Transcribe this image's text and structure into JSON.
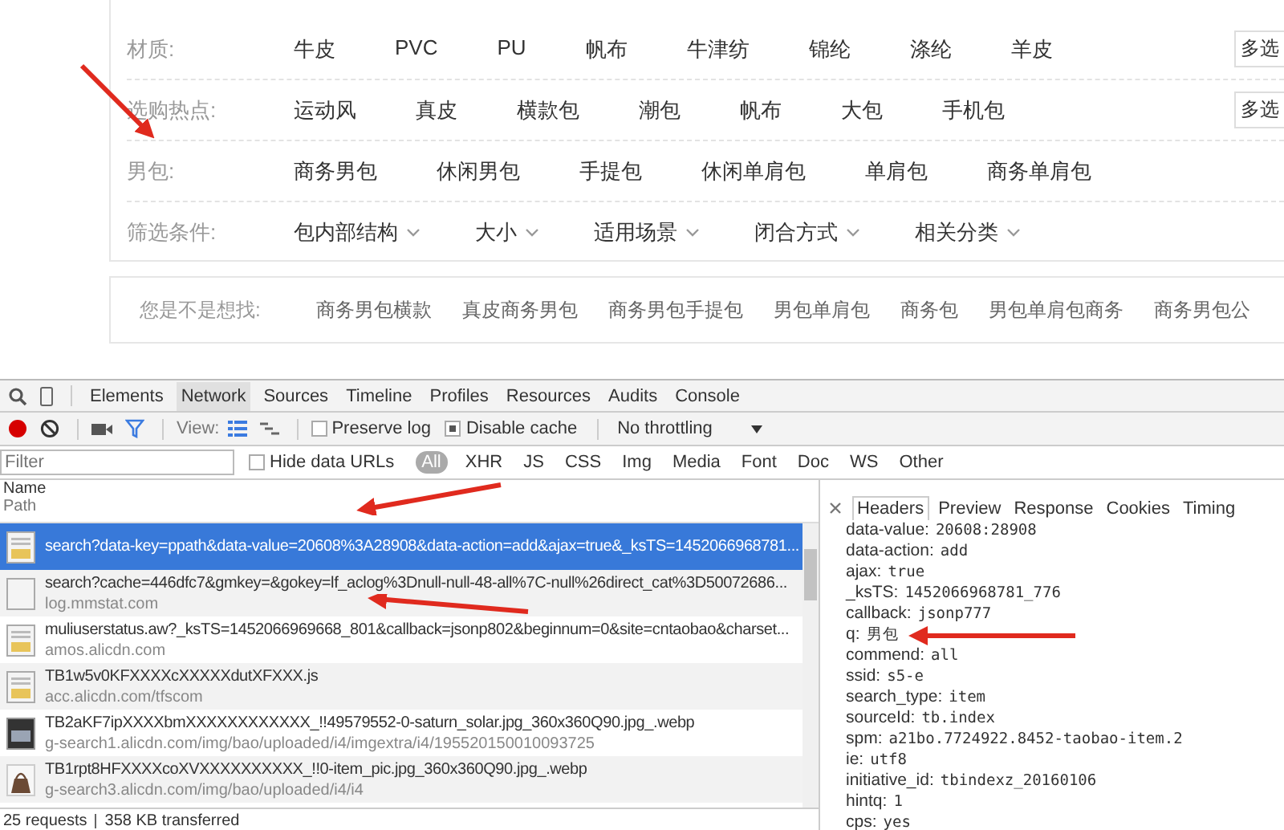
{
  "filters": [
    {
      "label": "材质:",
      "kind": "plain",
      "options": [
        "牛皮",
        "PVC",
        "PU",
        "帆布",
        "牛津纺",
        "锦纶",
        "涤纶",
        "羊皮"
      ],
      "multi": "多选"
    },
    {
      "label": "选购热点:",
      "kind": "plain",
      "options": [
        "运动风",
        "真皮",
        "横款包",
        "潮包",
        "帆布",
        "大包",
        "手机包"
      ],
      "multi": "多选"
    },
    {
      "label": "男包:",
      "kind": "plain",
      "options": [
        "商务男包",
        "休闲男包",
        "手提包",
        "休闲单肩包",
        "单肩包",
        "商务单肩包"
      ]
    },
    {
      "label": "筛选条件:",
      "kind": "dropdown",
      "options": [
        "包内部结构",
        "大小",
        "适用场景",
        "闭合方式",
        "相关分类"
      ]
    }
  ],
  "suggest": {
    "label": "您是不是想找:",
    "items": [
      "商务男包横款",
      "真皮商务男包",
      "商务男包手提包",
      "男包单肩包",
      "商务包",
      "男包单肩包商务",
      "商务男包公"
    ]
  },
  "devtools": {
    "tabs": [
      {
        "label": "Elements",
        "selected": false
      },
      {
        "label": "Network",
        "selected": true
      },
      {
        "label": "Sources",
        "selected": false
      },
      {
        "label": "Timeline",
        "selected": false
      },
      {
        "label": "Profiles",
        "selected": false
      },
      {
        "label": "Resources",
        "selected": false
      },
      {
        "label": "Audits",
        "selected": false
      },
      {
        "label": "Console",
        "selected": false
      }
    ],
    "recording": true,
    "view_label": "View:",
    "preserve_log": {
      "label": "Preserve log",
      "checked": false
    },
    "disable_cache": {
      "label": "Disable cache",
      "checked": true
    },
    "throttling": "No throttling",
    "filter": {
      "placeholder": "Filter"
    },
    "hide_data_urls": {
      "label": "Hide data URLs",
      "checked": false
    },
    "types": [
      {
        "label": "All",
        "selected": true
      },
      {
        "label": "XHR",
        "selected": false
      },
      {
        "label": "JS",
        "selected": false
      },
      {
        "label": "CSS",
        "selected": false
      },
      {
        "label": "Img",
        "selected": false
      },
      {
        "label": "Media",
        "selected": false
      },
      {
        "label": "Font",
        "selected": false
      },
      {
        "label": "Doc",
        "selected": false
      },
      {
        "label": "WS",
        "selected": false
      },
      {
        "label": "Other",
        "selected": false
      }
    ],
    "columns": [
      "Name",
      "Path"
    ],
    "requests": [
      {
        "kind": "js",
        "name": "search?data-key=ppath&data-value=20608%3A28908&data-action=add&ajax=true&_ksTS=1452066968781...",
        "selected": true
      },
      {
        "kind": "blank",
        "name": "search?cache=446dfc7&gmkey=&gokey=lf_aclog%3Dnull-null-48-all%7C-null%26direct_cat%3D50072686...",
        "path": "log.mmstat.com",
        "selected": false
      },
      {
        "kind": "js",
        "name": "muliuserstatus.aw?_ksTS=1452066969668_801&callback=jsonp802&beginnum=0&site=cntaobao&charset...",
        "path": "amos.alicdn.com",
        "selected": false
      },
      {
        "kind": "js",
        "name": "TB1w5v0KFXXXXcXXXXXdutXFXXX.js",
        "path": "acc.alicdn.com/tfscom",
        "selected": false
      },
      {
        "kind": "image",
        "name": "TB2aKF7ipXXXXbmXXXXXXXXXXXX_!!49579552-0-saturn_solar.jpg_360x360Q90.jpg_.webp",
        "path": "g-search1.alicdn.com/img/bao/uploaded/i4/imgextra/i4/195520150010093725",
        "selected": false
      },
      {
        "kind": "bag",
        "name": "TB1rpt8HFXXXXcoXVXXXXXXXXXX_!!0-item_pic.jpg_360x360Q90.jpg_.webp",
        "path": "g-search3.alicdn.com/img/bao/uploaded/i4/i4",
        "selected": false
      }
    ],
    "status": [
      "25 requests",
      "358 KB transferred"
    ],
    "detail_tabs": [
      {
        "label": "Headers",
        "selected": true
      },
      {
        "label": "Preview",
        "selected": false
      },
      {
        "label": "Response",
        "selected": false
      },
      {
        "label": "Cookies",
        "selected": false
      },
      {
        "label": "Timing",
        "selected": false
      }
    ],
    "params": [
      {
        "key": "data-value:",
        "value": "20608:28908"
      },
      {
        "key": "data-action:",
        "value": "add"
      },
      {
        "key": "ajax:",
        "value": "true"
      },
      {
        "key": "_ksTS:",
        "value": "1452066968781_776"
      },
      {
        "key": "callback:",
        "value": "jsonp777"
      },
      {
        "key": "q:",
        "value": "男包"
      },
      {
        "key": "commend:",
        "value": "all"
      },
      {
        "key": "ssid:",
        "value": "s5-e"
      },
      {
        "key": "search_type:",
        "value": "item"
      },
      {
        "key": "sourceId:",
        "value": "tb.index"
      },
      {
        "key": "spm:",
        "value": "a21bo.7724922.8452-taobao-item.2"
      },
      {
        "key": "ie:",
        "value": "utf8"
      },
      {
        "key": "initiative_id:",
        "value": "tbindexz_20160106"
      },
      {
        "key": "hintq:",
        "value": "1"
      },
      {
        "key": "cps:",
        "value": "yes"
      }
    ]
  }
}
